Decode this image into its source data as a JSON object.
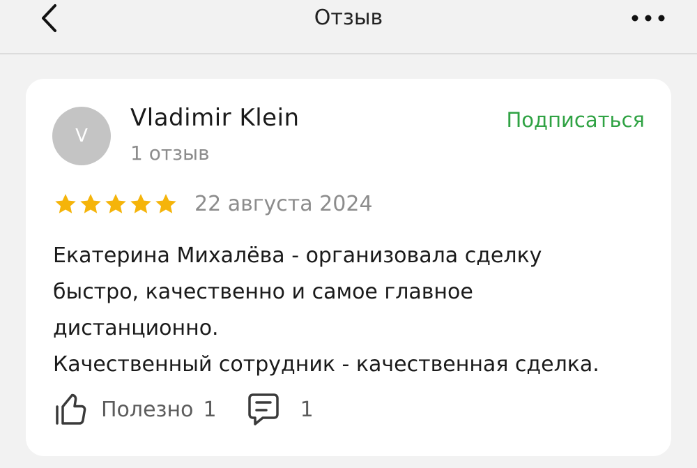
{
  "header": {
    "title": "Отзыв",
    "back_icon": "chevron-left-icon",
    "more_icon": "more-horizontal-icon"
  },
  "review": {
    "author": {
      "initial": "V",
      "name": "Vladimir Klein",
      "reviews_count": "1 отзыв"
    },
    "subscribe_label": "Подписаться",
    "rating": 5,
    "rating_max": 5,
    "date": "22 августа 2024",
    "text_lines": [
      "Екатерина Михалёва - организовала сделку",
      "быстро, качественно и самое главное",
      "дистанционно.",
      "Качественный сотрудник - качественная сделка."
    ],
    "useful_label": "Полезно",
    "useful_count": "1",
    "comments_count": "1"
  },
  "colors": {
    "accent_green": "#2fa243",
    "star_yellow": "#f5b40a",
    "secondary_text": "#8c8c8c",
    "avatar_bg": "#c4c4c4"
  }
}
